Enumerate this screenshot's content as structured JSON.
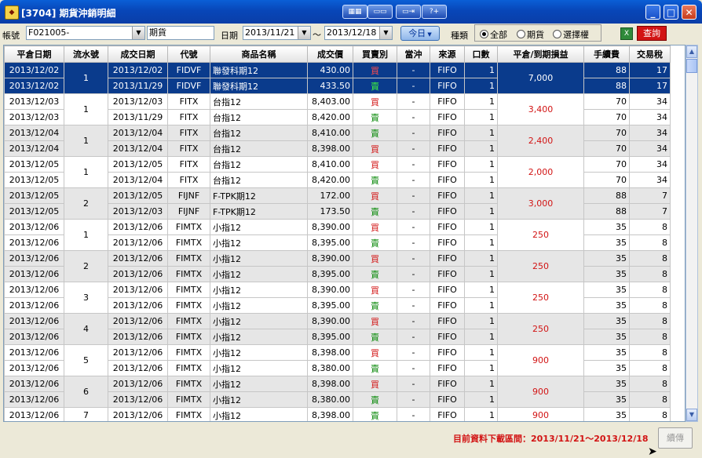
{
  "window": {
    "title": "[3704] 期貨沖銷明細"
  },
  "toolbar": {
    "account_label": "帳號",
    "account_value": "F021005-",
    "market_value": "期貨",
    "date_label": "日期",
    "date_from": "2013/11/21",
    "tilde": "～",
    "date_to": "2013/12/18",
    "today_button": "今日",
    "category_label": "種類",
    "radio_all": "全部",
    "radio_futures": "期貨",
    "radio_options": "選擇權",
    "query_button": "查詢"
  },
  "table": {
    "columns": [
      "平倉日期",
      "流水號",
      "成交日期",
      "代號",
      "商品名稱",
      "成交價",
      "買賣別",
      "當沖",
      "來源",
      "口數",
      "平倉/到期損益",
      "手續費",
      "交易稅"
    ],
    "groups": [
      {
        "serial": "1",
        "pnl": "7,000",
        "rows": [
          [
            "2013/12/02",
            "2013/12/02",
            "FIDVF",
            "聯發科期12",
            "430.00",
            "買",
            "-",
            "FIFO",
            "1",
            "88",
            "17"
          ],
          [
            "2013/12/02",
            "2013/11/29",
            "FIDVF",
            "聯發科期12",
            "433.50",
            "賣",
            "-",
            "FIFO",
            "1",
            "88",
            "17"
          ]
        ]
      },
      {
        "serial": "1",
        "pnl": "3,400",
        "rows": [
          [
            "2013/12/03",
            "2013/12/03",
            "FITX",
            "台指12",
            "8,403.00",
            "買",
            "-",
            "FIFO",
            "1",
            "70",
            "34"
          ],
          [
            "2013/12/03",
            "2013/11/29",
            "FITX",
            "台指12",
            "8,420.00",
            "賣",
            "-",
            "FIFO",
            "1",
            "70",
            "34"
          ]
        ]
      },
      {
        "serial": "1",
        "pnl": "2,400",
        "rows": [
          [
            "2013/12/04",
            "2013/12/04",
            "FITX",
            "台指12",
            "8,410.00",
            "賣",
            "-",
            "FIFO",
            "1",
            "70",
            "34"
          ],
          [
            "2013/12/04",
            "2013/12/04",
            "FITX",
            "台指12",
            "8,398.00",
            "買",
            "-",
            "FIFO",
            "1",
            "70",
            "34"
          ]
        ]
      },
      {
        "serial": "1",
        "pnl": "2,000",
        "rows": [
          [
            "2013/12/05",
            "2013/12/05",
            "FITX",
            "台指12",
            "8,410.00",
            "買",
            "-",
            "FIFO",
            "1",
            "70",
            "34"
          ],
          [
            "2013/12/05",
            "2013/12/04",
            "FITX",
            "台指12",
            "8,420.00",
            "賣",
            "-",
            "FIFO",
            "1",
            "70",
            "34"
          ]
        ]
      },
      {
        "serial": "2",
        "pnl": "3,000",
        "rows": [
          [
            "2013/12/05",
            "2013/12/05",
            "FIJNF",
            "F-TPK期12",
            "172.00",
            "買",
            "-",
            "FIFO",
            "1",
            "88",
            "7"
          ],
          [
            "2013/12/05",
            "2013/12/03",
            "FIJNF",
            "F-TPK期12",
            "173.50",
            "賣",
            "-",
            "FIFO",
            "1",
            "88",
            "7"
          ]
        ]
      },
      {
        "serial": "1",
        "pnl": "250",
        "rows": [
          [
            "2013/12/06",
            "2013/12/06",
            "FIMTX",
            "小指12",
            "8,390.00",
            "買",
            "-",
            "FIFO",
            "1",
            "35",
            "8"
          ],
          [
            "2013/12/06",
            "2013/12/06",
            "FIMTX",
            "小指12",
            "8,395.00",
            "賣",
            "-",
            "FIFO",
            "1",
            "35",
            "8"
          ]
        ]
      },
      {
        "serial": "2",
        "pnl": "250",
        "rows": [
          [
            "2013/12/06",
            "2013/12/06",
            "FIMTX",
            "小指12",
            "8,390.00",
            "買",
            "-",
            "FIFO",
            "1",
            "35",
            "8"
          ],
          [
            "2013/12/06",
            "2013/12/06",
            "FIMTX",
            "小指12",
            "8,395.00",
            "賣",
            "-",
            "FIFO",
            "1",
            "35",
            "8"
          ]
        ]
      },
      {
        "serial": "3",
        "pnl": "250",
        "rows": [
          [
            "2013/12/06",
            "2013/12/06",
            "FIMTX",
            "小指12",
            "8,390.00",
            "買",
            "-",
            "FIFO",
            "1",
            "35",
            "8"
          ],
          [
            "2013/12/06",
            "2013/12/06",
            "FIMTX",
            "小指12",
            "8,395.00",
            "賣",
            "-",
            "FIFO",
            "1",
            "35",
            "8"
          ]
        ]
      },
      {
        "serial": "4",
        "pnl": "250",
        "rows": [
          [
            "2013/12/06",
            "2013/12/06",
            "FIMTX",
            "小指12",
            "8,390.00",
            "買",
            "-",
            "FIFO",
            "1",
            "35",
            "8"
          ],
          [
            "2013/12/06",
            "2013/12/06",
            "FIMTX",
            "小指12",
            "8,395.00",
            "賣",
            "-",
            "FIFO",
            "1",
            "35",
            "8"
          ]
        ]
      },
      {
        "serial": "5",
        "pnl": "900",
        "rows": [
          [
            "2013/12/06",
            "2013/12/06",
            "FIMTX",
            "小指12",
            "8,398.00",
            "買",
            "-",
            "FIFO",
            "1",
            "35",
            "8"
          ],
          [
            "2013/12/06",
            "2013/12/06",
            "FIMTX",
            "小指12",
            "8,380.00",
            "賣",
            "-",
            "FIFO",
            "1",
            "35",
            "8"
          ]
        ]
      },
      {
        "serial": "6",
        "pnl": "900",
        "rows": [
          [
            "2013/12/06",
            "2013/12/06",
            "FIMTX",
            "小指12",
            "8,398.00",
            "買",
            "-",
            "FIFO",
            "1",
            "35",
            "8"
          ],
          [
            "2013/12/06",
            "2013/12/06",
            "FIMTX",
            "小指12",
            "8,380.00",
            "賣",
            "-",
            "FIFO",
            "1",
            "35",
            "8"
          ]
        ]
      },
      {
        "serial": "7",
        "pnl": "900",
        "rows": [
          [
            "2013/12/06",
            "2013/12/06",
            "FIMTX",
            "小指12",
            "8,398.00",
            "賣",
            "-",
            "FIFO",
            "1",
            "35",
            "8"
          ]
        ]
      }
    ]
  },
  "status": {
    "download_range": "目前資料下載區間：2013/11/21～2013/12/18",
    "continue_button": "續傳"
  },
  "colors": {
    "buy": "#d21414",
    "sell": "#0b8a0b",
    "selected_row": "#0a3b8c"
  }
}
